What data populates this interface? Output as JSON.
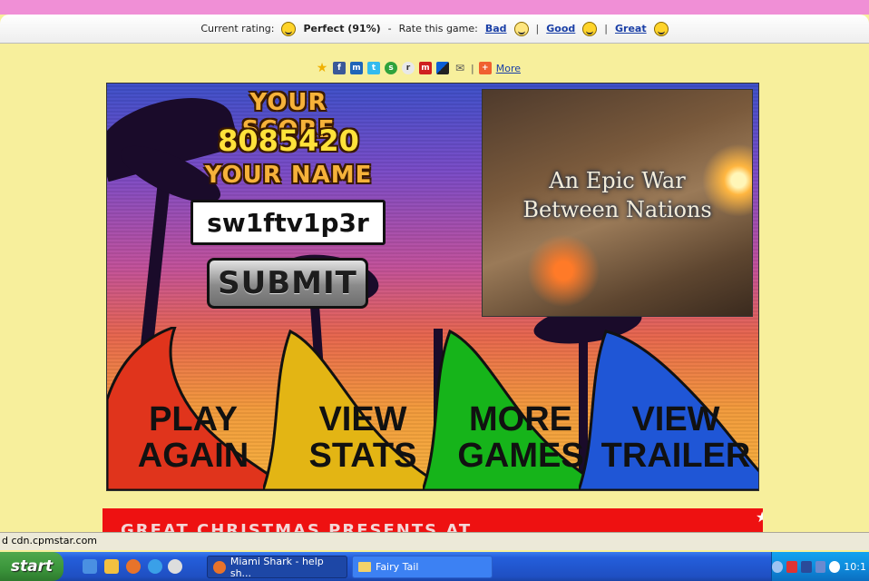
{
  "rating_bar": {
    "current_label": "Current rating:",
    "current_value": "Perfect (91%)",
    "dash": "-",
    "rate_label": "Rate this game:",
    "options": [
      "Bad",
      "Good",
      "Great"
    ],
    "separator": "|"
  },
  "share": {
    "separator": "|",
    "more_label": "More",
    "icons": [
      "favorite-star-icon",
      "facebook-icon",
      "myspace-icon",
      "twitter-icon",
      "stumbleupon-icon",
      "reddit-icon",
      "mixx-icon",
      "delicious-icon",
      "email-icon",
      "add-more-icon"
    ]
  },
  "game": {
    "score_title": "YOUR SCORE",
    "score_value": "8085420",
    "name_title": "YOUR NAME",
    "name_value": "sw1ftv1p3r",
    "submit_label": "SUBMIT",
    "trailer_line1": "An Epic War",
    "trailer_line2": "Between Nations",
    "fins": [
      {
        "line1": "PLAY",
        "line2": "AGAIN",
        "color": "#e0341c"
      },
      {
        "line1": "VIEW",
        "line2": "STATS",
        "color": "#e3b514"
      },
      {
        "line1": "MORE",
        "line2": "GAMES",
        "color": "#16b41a"
      },
      {
        "line1": "VIEW",
        "line2": "TRAILER",
        "color": "#1f56d6"
      }
    ]
  },
  "banner": {
    "text": "GREAT CHRISTMAS PRESENTS AT"
  },
  "status_bar": {
    "text": "d cdn.cpmstar.com"
  },
  "taskbar": {
    "start_label": "start",
    "tasks": [
      "Miami Shark - help sh...",
      "Fairy Tail"
    ],
    "clock": "10:1"
  }
}
